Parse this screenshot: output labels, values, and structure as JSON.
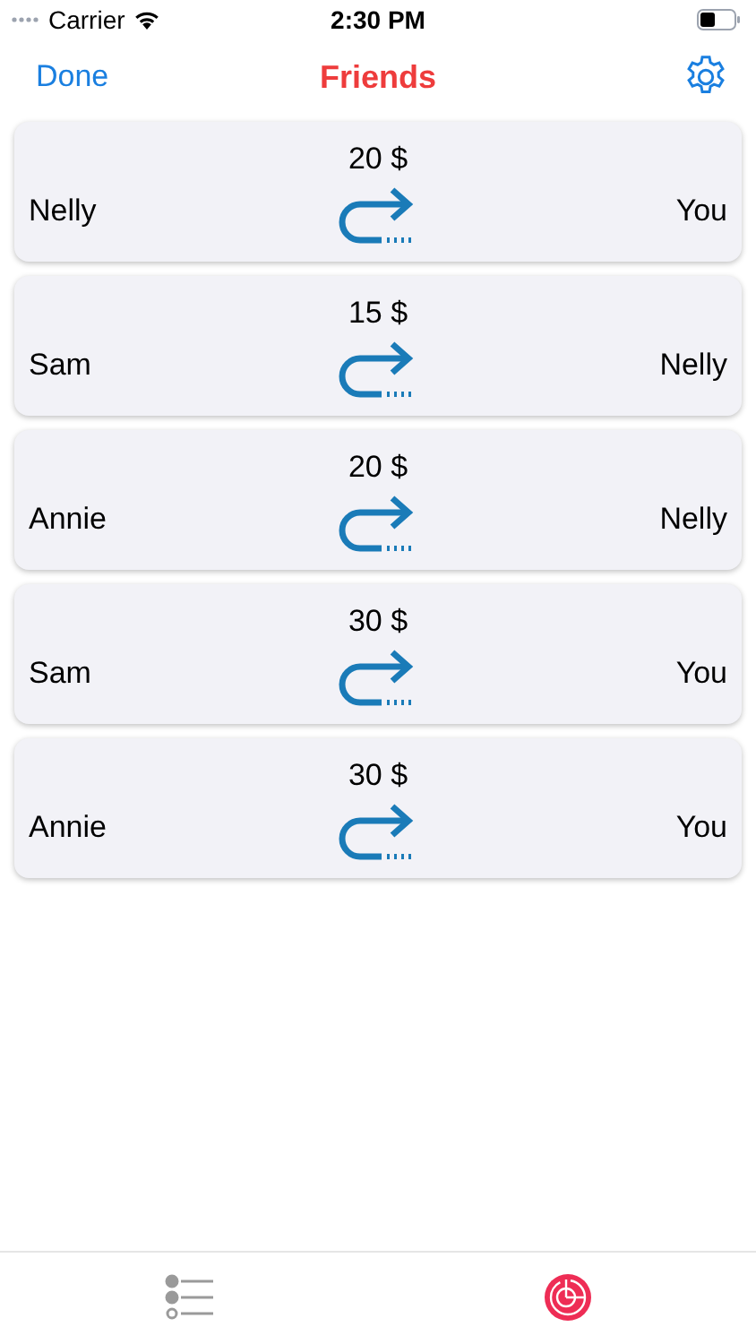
{
  "status_bar": {
    "carrier": "Carrier",
    "time": "2:30 PM"
  },
  "nav_bar": {
    "left_button": "Done",
    "title": "Friends"
  },
  "debts": [
    {
      "from": "Nelly",
      "amount": "20 $",
      "to": "You"
    },
    {
      "from": "Sam",
      "amount": "15 $",
      "to": "Nelly"
    },
    {
      "from": "Annie",
      "amount": "20 $",
      "to": "Nelly"
    },
    {
      "from": "Sam",
      "amount": "30 $",
      "to": "You"
    },
    {
      "from": "Annie",
      "amount": "30 $",
      "to": "You"
    }
  ],
  "tab_bar": [
    {
      "kind": "list",
      "selected": false
    },
    {
      "kind": "radar",
      "selected": true
    }
  ]
}
